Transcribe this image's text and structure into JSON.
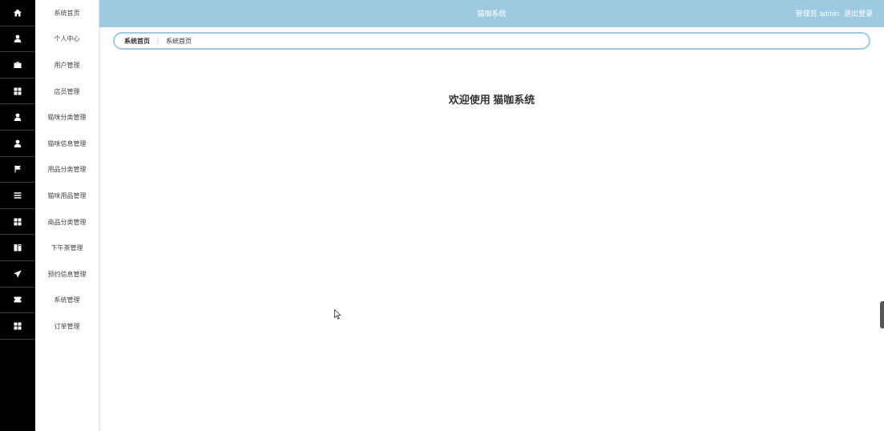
{
  "header": {
    "title": "猫咖系统",
    "role": "管理员",
    "username": "admin",
    "logout": "退出登录"
  },
  "breadcrumb": {
    "root": "系统首页",
    "separator": "⋮",
    "current": "系统首页"
  },
  "main": {
    "welcome": "欢迎使用 猫咖系统"
  },
  "menu": [
    {
      "label": "系统首页",
      "icon": "home-icon"
    },
    {
      "label": "个人中心",
      "icon": "user-icon"
    },
    {
      "label": "用户管理",
      "icon": "briefcase-icon"
    },
    {
      "label": "店员管理",
      "icon": "grid-icon"
    },
    {
      "label": "猫咪分类管理",
      "icon": "user-icon"
    },
    {
      "label": "猫咪信息管理",
      "icon": "user-icon"
    },
    {
      "label": "用品分类管理",
      "icon": "flag-icon"
    },
    {
      "label": "猫咪用品管理",
      "icon": "list-icon"
    },
    {
      "label": "商品分类管理",
      "icon": "grid-icon"
    },
    {
      "label": "下午茶管理",
      "icon": "book-icon"
    },
    {
      "label": "预约信息管理",
      "icon": "send-icon"
    },
    {
      "label": "系统管理",
      "icon": "ticket-icon"
    },
    {
      "label": "订单管理",
      "icon": "grid-icon"
    }
  ],
  "colors": {
    "header_bg": "#9ecae1",
    "rail_bg": "#000000",
    "accent_border": "#9ecae1"
  }
}
